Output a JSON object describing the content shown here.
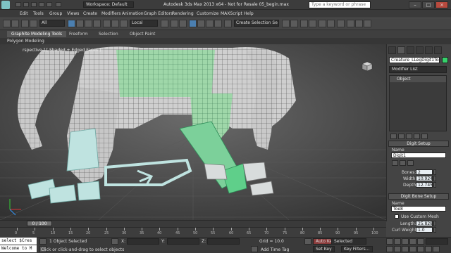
{
  "app": {
    "workspace": "Workspace: Default",
    "title": "Autodesk 3ds Max  2013 x64  - Not for Resale    05_begin.max",
    "search_placeholder": "Type a keyword or phrase"
  },
  "menu": [
    "Edit",
    "Tools",
    "Group",
    "Views",
    "Create",
    "Modifiers",
    "Animation",
    "Graph Editors",
    "Rendering",
    "Customize",
    "MAXScript",
    "Help"
  ],
  "toolbar": {
    "selection_filter": "All",
    "ref_coord": "Local",
    "named_selection": "Create Selection Se"
  },
  "ribbon": {
    "tabs": [
      "Graphite Modeling Tools",
      "Freeform",
      "Selection",
      "Object Paint"
    ],
    "active_tab": "Graphite Modeling Tools",
    "subpanel": "Polygon Modeling"
  },
  "viewport": {
    "label": "[ + ] [ Perspective ] [ Shaded + Edged Faces ]",
    "label_visible": "rspective ] [ Shaded + Edged Faces ]"
  },
  "command_panel": {
    "object_name": "Creature_LLegDigit1Toe8",
    "object_color": "#35d26b",
    "modifier_list": "Modifier List",
    "stack": [
      "Object"
    ],
    "digit_setup": {
      "title": "Digit Setup",
      "name_label": "Name",
      "name_value": "Digit1",
      "bones_label": "Bones:",
      "bones_value": "2",
      "width_label": "Width",
      "width_value": "10.924",
      "depth_label": "Depth",
      "depth_value": "12.745"
    },
    "digit_bone_setup": {
      "title": "Digit Bone Setup",
      "name_label": "Name",
      "name_value": "Toe8",
      "use_custom_mesh_label": "Use Custom Mesh",
      "length_label": "Length:",
      "length_value": "25.828",
      "curl_weight_label": "Curl Weight:",
      "curl_weight_value": "1.0"
    }
  },
  "timeline": {
    "slider_text": "0 / 100",
    "ticks": [
      "0",
      "5",
      "10",
      "15",
      "20",
      "25",
      "30",
      "35",
      "40",
      "45",
      "50",
      "55",
      "60",
      "65",
      "70",
      "75",
      "80",
      "85",
      "90",
      "95",
      "100"
    ]
  },
  "status": {
    "listener_line1": "select $Cres",
    "listener_line2": "Welcome to M",
    "selection_status": "1 Object Selected",
    "prompt": "Click or click-and-drag to select objects",
    "x_label": "X:",
    "y_label": "Y:",
    "z_label": "Z:",
    "grid": "Grid = 10.0",
    "auto_key": "Auto Key",
    "set_key": "Set Key",
    "key_mode": "Selected",
    "key_filters": "Key Filters...",
    "add_time_tag": "Add Time Tag"
  }
}
